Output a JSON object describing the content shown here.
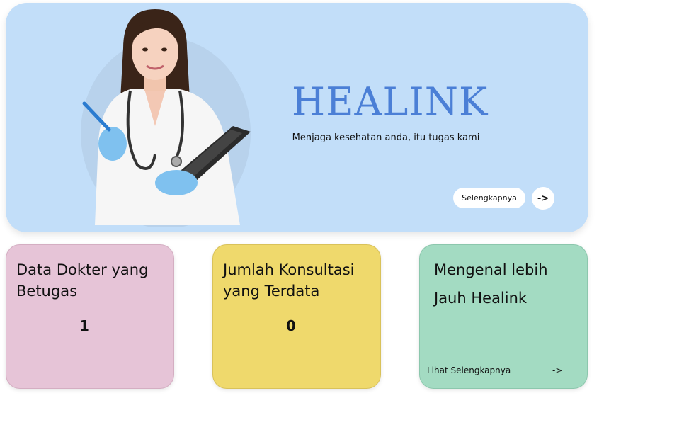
{
  "hero": {
    "title": "HEALINK",
    "subtitle": "Menjaga kesehatan anda, itu tugas kami",
    "more_button": "Selengkapnya",
    "arrow_button": "->",
    "background_color": "#c2def9",
    "title_color": "#4b7fd6"
  },
  "cards": [
    {
      "title": "Data Dokter yang Betugas",
      "value": "1",
      "color": "#e6c4d7"
    },
    {
      "title": "Jumlah Konsultasi yang Terdata",
      "value": "0",
      "color": "#efd96c"
    },
    {
      "title": "Mengenal lebih Jauh Healink",
      "link": "Lihat Selengkapnya",
      "link_arrow": "->",
      "color": "#a3dbc2"
    }
  ]
}
